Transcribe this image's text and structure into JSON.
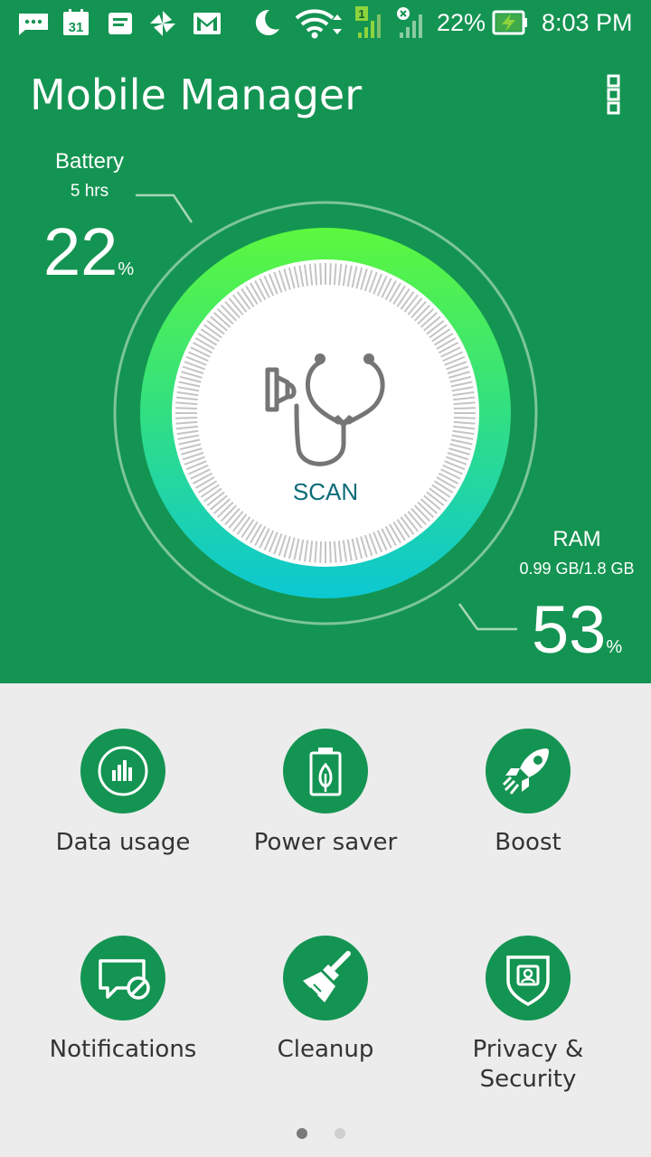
{
  "status_bar": {
    "icons": [
      "messages-icon",
      "calendar-icon",
      "notes-icon",
      "pinwheel-icon",
      "gmail-icon",
      "moon-icon",
      "wifi-icon",
      "sim1-signal-icon",
      "sim2-signal-icon",
      "battery-charging-icon"
    ],
    "calendar_day": "31",
    "sim_label": "1",
    "battery_percent": "22%",
    "time": "8:03 PM"
  },
  "app": {
    "title": "Mobile Manager",
    "menu_icon": "more-vert-icon"
  },
  "battery": {
    "label": "Battery",
    "time_left": "5 hrs",
    "value": "22",
    "unit": "%"
  },
  "ram": {
    "label": "RAM",
    "usage": "0.99 GB/1.8 GB",
    "value": "53",
    "unit": "%"
  },
  "scan": {
    "label": "SCAN",
    "icon": "stethoscope-icon"
  },
  "tiles": [
    {
      "label": "Data usage",
      "icon": "data-usage-icon"
    },
    {
      "label": "Power saver",
      "icon": "power-saver-icon"
    },
    {
      "label": "Boost",
      "icon": "rocket-icon"
    },
    {
      "label": "Notifications",
      "icon": "notifications-block-icon"
    },
    {
      "label": "Cleanup",
      "icon": "broom-icon"
    },
    {
      "label": "Privacy &\nSecurity",
      "icon": "shield-user-icon"
    }
  ],
  "pager": {
    "pages": 2,
    "current": 1
  },
  "colors": {
    "primary": "#149452",
    "ring_top": "#5cf83e",
    "ring_bottom": "#0cc8d2",
    "scan_text": "#0b6b78",
    "background": "#ececec"
  }
}
